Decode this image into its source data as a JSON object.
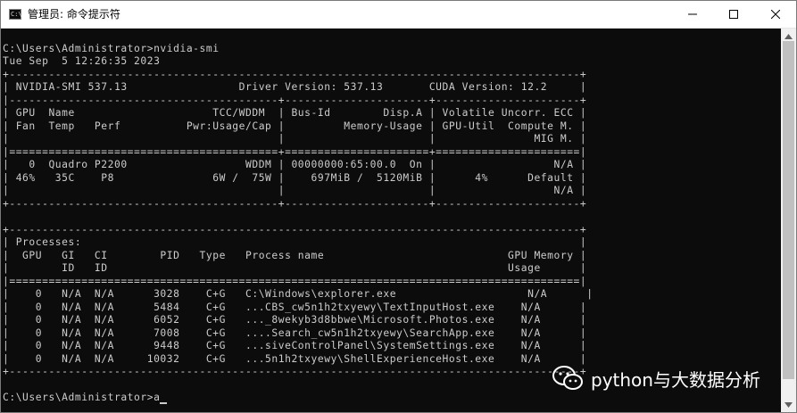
{
  "window": {
    "title": "管理员: 命令提示符",
    "icon": "cmd-icon",
    "icon_text": "C:\\",
    "controls": [
      "minimize-icon",
      "maximize-icon",
      "close-icon"
    ]
  },
  "console": {
    "lines": [
      "",
      "C:\\Users\\Administrator>nvidia-smi",
      "Tue Sep  5 12:26:35 2023",
      "+---------------------------------------------------------------------------------------+",
      "| NVIDIA-SMI 537.13                 Driver Version: 537.13       CUDA Version: 12.2     |",
      "|-----------------------------------------+----------------------+----------------------+",
      "| GPU  Name                     TCC/WDDM  | Bus-Id        Disp.A | Volatile Uncorr. ECC |",
      "| Fan  Temp   Perf          Pwr:Usage/Cap |         Memory-Usage | GPU-Util  Compute M. |",
      "|                                         |                      |               MIG M. |",
      "|=========================================+======================+======================|",
      "|   0  Quadro P2200                  WDDM | 00000000:65:00.0  On |                  N/A |",
      "| 46%   35C    P8               6W /  75W |    697MiB /  5120MiB |      4%      Default |",
      "|                                         |                      |                  N/A |",
      "+-----------------------------------------+----------------------+----------------------+",
      "",
      "+---------------------------------------------------------------------------------------+",
      "| Processes:                                                                            |",
      "|  GPU   GI   CI        PID   Type   Process name                            GPU Memory |",
      "|        ID   ID                                                             Usage      |",
      "|=======================================================================================|",
      "|    0   N/A  N/A      3028    C+G   C:\\Windows\\explorer.exe                    N/A      |",
      "|    0   N/A  N/A      5484    C+G   ...CBS_cw5n1h2txyewy\\TextInputHost.exe    N/A      |",
      "|    0   N/A  N/A      6052    C+G   ..._8wekyb3d8bbwe\\Microsoft.Photos.exe    N/A      |",
      "|    0   N/A  N/A      7008    C+G   ....Search_cw5n1h2txyewy\\SearchApp.exe    N/A      |",
      "|    0   N/A  N/A      9448    C+G   ...siveControlPanel\\SystemSettings.exe    N/A      |",
      "|    0   N/A  N/A     10032    C+G   ...5n1h2txyewy\\ShellExperienceHost.exe    N/A      |",
      "+---------------------------------------------------------------------------------------+",
      "",
      "C:\\Users\\Administrator>a"
    ]
  },
  "watermark": {
    "icon": "wechat-icon",
    "text": "python与大数据分析"
  },
  "colors": {
    "console_bg": "#0c0c0c",
    "console_fg": "#cccccc",
    "titlebar_bg": "#ffffff",
    "scrollbar_bg": "#f0f0f0",
    "scrollbar_thumb": "#c0c0c0"
  }
}
